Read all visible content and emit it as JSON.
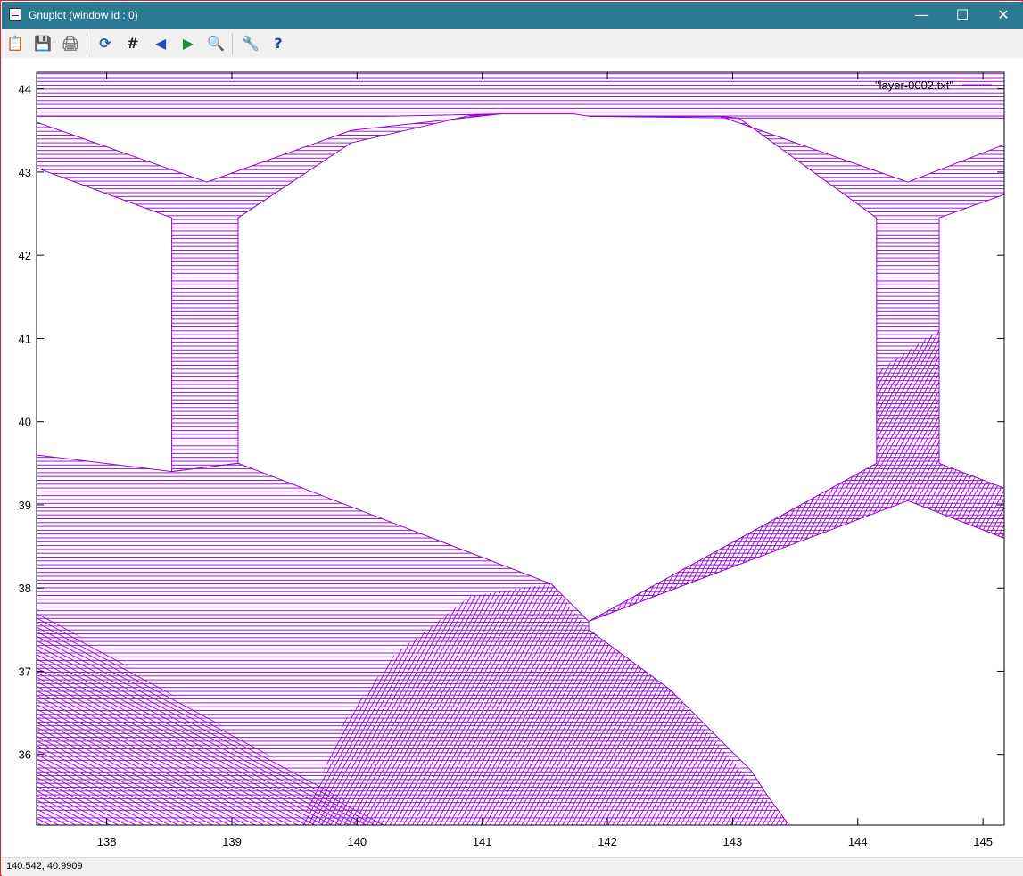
{
  "window": {
    "title": "Gnuplot (window id : 0)",
    "controls": {
      "minimize": "—",
      "maximize": "☐",
      "close": "✕"
    }
  },
  "toolbar": {
    "buttons": [
      {
        "name": "copy-to-clipboard",
        "glyph": "📋",
        "color": "#b07a2a"
      },
      {
        "name": "save",
        "glyph": "💾",
        "color": "#2f6fb0"
      },
      {
        "name": "print",
        "glyph": "🖨",
        "color": "#777777"
      },
      {
        "name": "replot",
        "glyph": "⟳",
        "color": "#1f5fbf"
      },
      {
        "name": "grid",
        "glyph": "#",
        "color": "#222222"
      },
      {
        "name": "zoom-previous",
        "glyph": "◀",
        "color": "#1f4fbf"
      },
      {
        "name": "zoom-next",
        "glyph": "▶",
        "color": "#1f8f3f"
      },
      {
        "name": "autoscale",
        "glyph": "🔍",
        "color": "#1f4fbf"
      },
      {
        "name": "options",
        "glyph": "🔧",
        "color": "#c88a10"
      },
      {
        "name": "help",
        "glyph": "?",
        "color": "#1f3fbf"
      }
    ]
  },
  "status": {
    "text": "140.542,  40.9909"
  },
  "chart_data": {
    "type": "line",
    "title": "",
    "xlabel": "",
    "ylabel": "",
    "xlim": [
      137.44,
      145.17
    ],
    "ylim": [
      35.15,
      44.2
    ],
    "xticks": [
      138,
      139,
      140,
      141,
      142,
      143,
      144,
      145
    ],
    "yticks": [
      36,
      37,
      38,
      39,
      40,
      41,
      42,
      43,
      44
    ],
    "grid": false,
    "legend": {
      "position": "top-right",
      "entries": [
        "\"layer-0002.txt\""
      ]
    },
    "series_color": "#9400d3",
    "series": [
      {
        "name": "\"layer-0002.txt\"",
        "outlines": [
          [
            [
              137.44,
              44.2
            ],
            [
              145.17,
              44.2
            ],
            [
              145.17,
              43.65
            ],
            [
              143.05,
              43.65
            ],
            [
              142.9,
              43.67
            ],
            [
              141.86,
              43.67
            ],
            [
              141.73,
              43.7
            ],
            [
              141.15,
              43.7
            ],
            [
              140.22,
              43.67
            ],
            [
              137.44,
              43.67
            ]
          ],
          [
            [
              137.44,
              43.6
            ],
            [
              138.8,
              42.88
            ],
            [
              139.95,
              43.5
            ],
            [
              141.15,
              43.7
            ],
            [
              140.9,
              43.68
            ],
            [
              139.95,
              43.35
            ],
            [
              139.05,
              42.45
            ],
            [
              139.05,
              39.5
            ],
            [
              138.52,
              39.4
            ],
            [
              138.52,
              42.45
            ],
            [
              137.44,
              43.05
            ]
          ],
          [
            [
              141.86,
              43.67
            ],
            [
              142.9,
              43.67
            ],
            [
              144.4,
              42.88
            ],
            [
              145.17,
              43.33
            ],
            [
              145.17,
              42.73
            ],
            [
              144.65,
              42.45
            ],
            [
              144.65,
              39.5
            ],
            [
              145.17,
              39.2
            ],
            [
              145.17,
              38.6
            ],
            [
              144.4,
              39.05
            ],
            [
              141.85,
              37.6
            ],
            [
              141.55,
              38.05
            ],
            [
              139.05,
              39.5
            ],
            [
              138.52,
              39.4
            ],
            [
              137.44,
              39.6
            ],
            [
              137.44,
              35.15
            ],
            [
              143.45,
              35.15
            ],
            [
              143.28,
              35.5
            ],
            [
              143.15,
              35.8
            ],
            [
              142.5,
              36.78
            ],
            [
              141.85,
              37.5
            ],
            [
              141.85,
              37.6
            ],
            [
              144.15,
              39.5
            ],
            [
              144.15,
              42.45
            ],
            [
              143.05,
              43.65
            ]
          ]
        ]
      }
    ]
  }
}
